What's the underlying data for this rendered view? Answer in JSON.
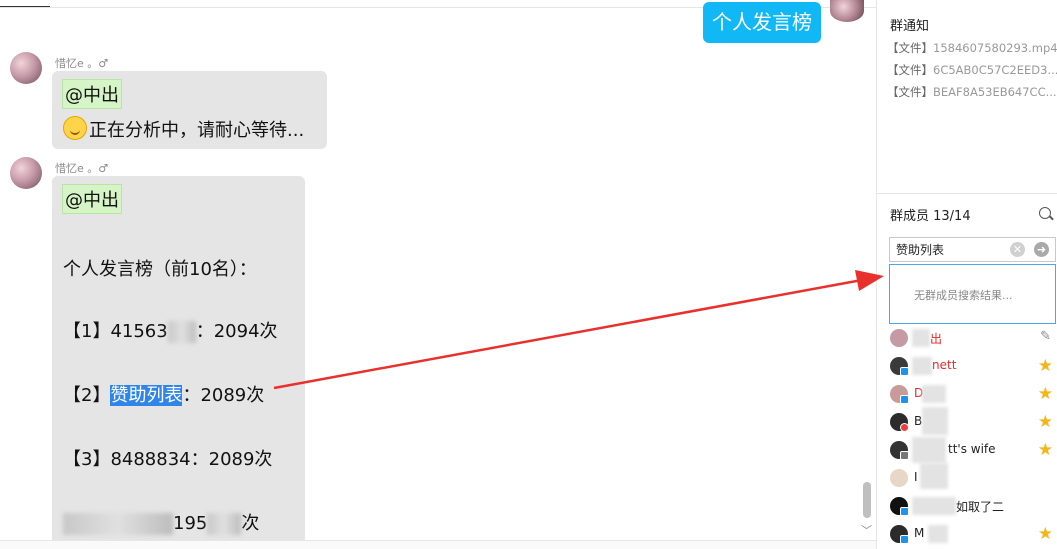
{
  "chat": {
    "sent_message": "个人发言榜",
    "messages": [
      {
        "sender": "惜忆e 。♂",
        "mention": "@中出",
        "text": "正在分析中，请耐心等待..."
      },
      {
        "sender": "惜忆e 。♂",
        "mention": "@中出",
        "title": "个人发言榜（前10名）：",
        "ranks": [
          {
            "rank": "【1】",
            "name": "41563",
            "sep": "：",
            "count": "2094次"
          },
          {
            "rank": "【2】",
            "name": "赞助列表",
            "sep": "：",
            "count": "2089次"
          },
          {
            "rank": "【3】",
            "name": "8488834",
            "sep": "：",
            "count": "2089次"
          },
          {
            "rank": "",
            "name": "",
            "sep": "",
            "count": "195",
            "tail": "次"
          }
        ]
      }
    ]
  },
  "panel": {
    "notice_title": "群通知",
    "notices": [
      {
        "tag": "【文件】",
        "name": "1584607580293.mp4"
      },
      {
        "tag": "【文件】",
        "name": "6C5AB0C57C2EED3..."
      },
      {
        "tag": "【文件】",
        "name": "BEAF8A53EB647CC..."
      }
    ],
    "members_title": "群成员 13/14",
    "search_value": "赞助列表",
    "no_result": "无群成员搜索结果...",
    "members": [
      {
        "name": "出",
        "color": "red",
        "icon": "pencil-icon"
      },
      {
        "name": "nett",
        "color": "red",
        "icon": "star-icon"
      },
      {
        "name": "D",
        "color": "red",
        "icon": "star-icon"
      },
      {
        "name": "B",
        "color": "normal",
        "icon": "star-icon"
      },
      {
        "name": "tt's wife",
        "color": "normal",
        "icon": "star-icon"
      },
      {
        "name": "I",
        "color": "normal",
        "icon": ""
      },
      {
        "name": "如取了二",
        "color": "normal",
        "icon": ""
      },
      {
        "name": "M",
        "color": "normal",
        "icon": "star-icon"
      }
    ]
  },
  "colors": {
    "sent_bubble": "#12b7f5",
    "highlight": "#2f86e8",
    "mention_bg": "#d6f5c6",
    "arrow": "#e8312d",
    "star": "#f5b51b"
  }
}
